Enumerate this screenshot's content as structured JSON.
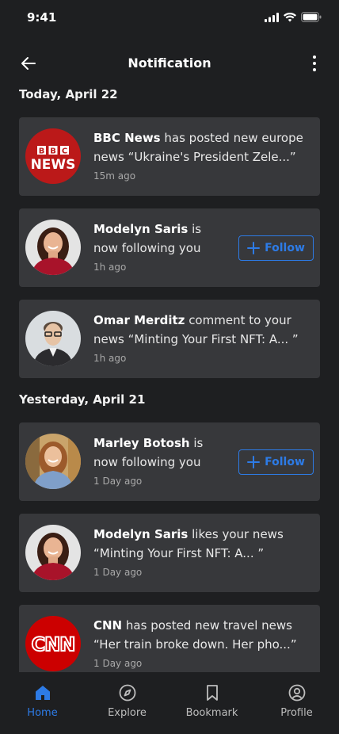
{
  "status": {
    "time": "9:41"
  },
  "header": {
    "title": "Notification"
  },
  "sections": [
    {
      "title": "Today, April 22"
    },
    {
      "title": "Yesterday, April 21"
    }
  ],
  "notifications": [
    {
      "actor": "BBC News",
      "text": "has posted new europe",
      "text2": "news “Ukraine's President Zele...”",
      "time": "15m ago",
      "avatar": "bbc-logo"
    },
    {
      "actor": "Modelyn Saris",
      "text": "is",
      "text2": "now following you",
      "time": "1h ago",
      "avatar": "woman-photo",
      "action": "Follow"
    },
    {
      "actor": "Omar Merditz",
      "text": "comment to your",
      "text2": "news “Minting Your First NFT: A... ”",
      "time": "1h ago",
      "avatar": "man-photo"
    },
    {
      "actor": "Marley Botosh",
      "text": "is",
      "text2": "now following you",
      "time": "1 Day ago",
      "avatar": "woman-photo-2",
      "action": "Follow"
    },
    {
      "actor": "Modelyn Saris",
      "text": "likes your news",
      "text2": "“Minting Your First NFT: A... ”",
      "time": "1 Day ago",
      "avatar": "woman-photo"
    },
    {
      "actor": "CNN",
      "text": "has posted new travel news",
      "text2": "“Her train broke down. Her pho...”",
      "time": "1 Day ago",
      "avatar": "cnn-logo"
    }
  ],
  "tabs": [
    {
      "label": "Home",
      "icon": "home-icon",
      "active": true
    },
    {
      "label": "Explore",
      "icon": "compass-icon"
    },
    {
      "label": "Bookmark",
      "icon": "bookmark-icon"
    },
    {
      "label": "Profile",
      "icon": "profile-icon"
    }
  ],
  "colors": {
    "background": "#1e1f21",
    "card": "#37383b",
    "accent": "#2d7be6",
    "bbc_red": "#bb1919",
    "cnn_red": "#cc0000"
  }
}
